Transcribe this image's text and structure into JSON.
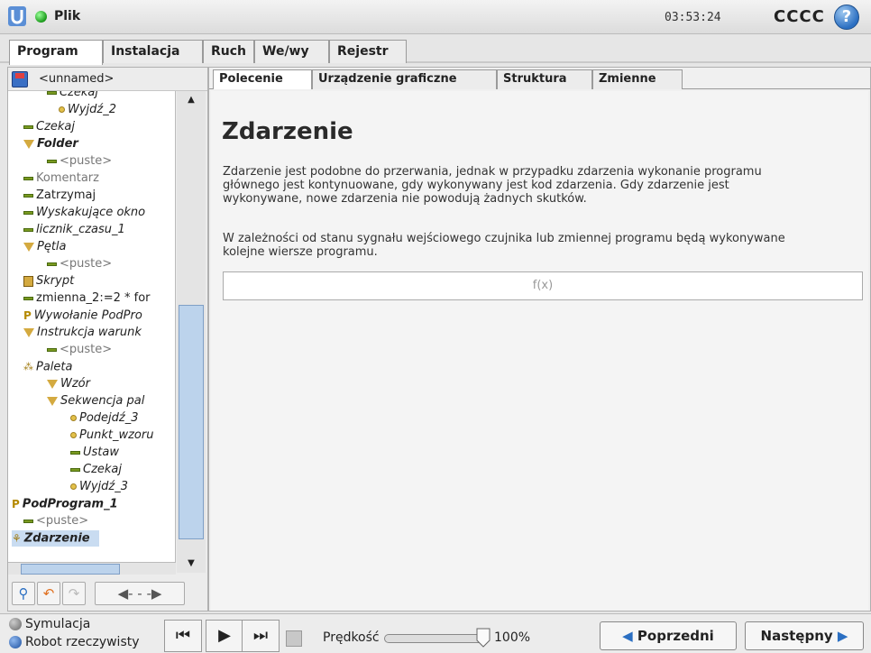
{
  "topbar": {
    "file_label": "Plik",
    "clock": "03:53:24",
    "robot_name": "CCCC",
    "help": "?"
  },
  "main_tabs": [
    "Program",
    "Instalacja",
    "Ruch",
    "We/wy",
    "Rejestr"
  ],
  "program_name": "<unnamed>",
  "tree": [
    {
      "label": "Czekaj",
      "indent": 3,
      "icon": "dash",
      "style": "i"
    },
    {
      "label": "Wyjdź_2",
      "indent": 4,
      "icon": "dot",
      "style": "i"
    },
    {
      "label": "Czekaj",
      "indent": 1,
      "icon": "dash",
      "style": "i"
    },
    {
      "label": "Folder",
      "indent": 1,
      "icon": "tri",
      "style": "bi"
    },
    {
      "label": "<puste>",
      "indent": 3,
      "icon": "dash",
      "style": "gray"
    },
    {
      "label": "Komentarz",
      "indent": 1,
      "icon": "dash",
      "style": "gray"
    },
    {
      "label": "Zatrzymaj",
      "indent": 1,
      "icon": "dash",
      "style": ""
    },
    {
      "label": "Wyskakujące okno",
      "indent": 1,
      "icon": "dash",
      "style": "i"
    },
    {
      "label": "licznik_czasu_1",
      "indent": 1,
      "icon": "dash",
      "style": "i"
    },
    {
      "label": "Pętla",
      "indent": 1,
      "icon": "tri",
      "style": "i"
    },
    {
      "label": "<puste>",
      "indent": 3,
      "icon": "dash",
      "style": "gray"
    },
    {
      "label": "Skrypt",
      "indent": 1,
      "icon": "s",
      "style": "i"
    },
    {
      "label": "zmienna_2:=2 * for",
      "indent": 1,
      "icon": "dash",
      "style": ""
    },
    {
      "label": "Wywołanie PodPro",
      "indent": 1,
      "icon": "p",
      "style": "i"
    },
    {
      "label": "Instrukcja warunk",
      "indent": 1,
      "icon": "tri",
      "style": "i"
    },
    {
      "label": "<puste>",
      "indent": 3,
      "icon": "dash",
      "style": "gray"
    },
    {
      "label": "Paleta",
      "indent": 1,
      "icon": "pal",
      "style": "i"
    },
    {
      "label": "Wzór",
      "indent": 3,
      "icon": "tri",
      "style": "i"
    },
    {
      "label": "Sekwencja pal",
      "indent": 3,
      "icon": "tri",
      "style": "i"
    },
    {
      "label": "Podejdź_3",
      "indent": 5,
      "icon": "dot",
      "style": "i"
    },
    {
      "label": "Punkt_wzoru",
      "indent": 5,
      "icon": "dot",
      "style": "i"
    },
    {
      "label": "Ustaw",
      "indent": 5,
      "icon": "dash",
      "style": "i"
    },
    {
      "label": "Czekaj",
      "indent": 5,
      "icon": "dash",
      "style": "i"
    },
    {
      "label": "Wyjdź_3",
      "indent": 5,
      "icon": "dot",
      "style": "i"
    },
    {
      "label": "PodProgram_1",
      "indent": 0,
      "icon": "p",
      "style": "bi"
    },
    {
      "label": "<puste>",
      "indent": 1,
      "icon": "dash",
      "style": "gray"
    },
    {
      "label": "Zdarzenie",
      "indent": 0,
      "icon": "ev",
      "style": "bi sel"
    }
  ],
  "sub_tabs": [
    "Polecenie",
    "Urządzenie graficzne",
    "Struktura",
    "Zmienne"
  ],
  "content": {
    "title": "Zdarzenie",
    "para1": "Zdarzenie jest podobne do przerwania, jednak w przypadku zdarzenia wykonanie programu głównego jest kontynuowane, gdy wykonywany jest kod zdarzenia. Gdy zdarzenie jest wykonywane, nowe zdarzenia nie powodują żadnych skutków.",
    "para2": "W zależności od stanu sygnału wejściowego czujnika lub zmiennej programu będą wykonywane kolejne wiersze programu.",
    "fx_placeholder": "f(x)"
  },
  "footer": {
    "sim_label": "Symulacja",
    "real_label": "Robot rzeczywisty",
    "speed_label": "Prędkość",
    "speed_value": "100%",
    "speed_fraction": 1.0,
    "prev_label": "Poprzedni",
    "next_label": "Następny"
  },
  "colors": {
    "accent": "#2b6fc2",
    "status": "#1a9a1a"
  }
}
